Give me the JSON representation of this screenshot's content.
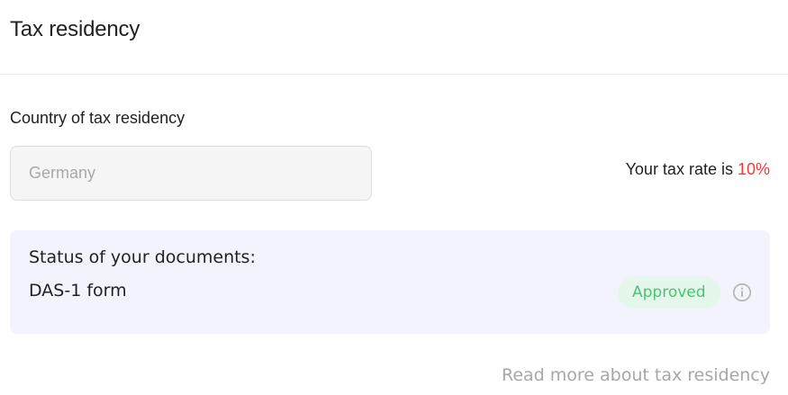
{
  "header": {
    "title": "Tax residency"
  },
  "tax_residency": {
    "country_label": "Country of tax residency",
    "country_placeholder": "Germany",
    "tax_rate_prefix": "Your tax rate is ",
    "tax_rate_value": "10%"
  },
  "documents": {
    "heading": "Status of your documents:",
    "items": [
      {
        "name": "DAS-1 form",
        "status": "Approved",
        "status_color": "#45c76c",
        "status_background": "#e5f7eb",
        "info_icon": "info-circle-icon"
      }
    ]
  },
  "links": {
    "read_more": "Read more about tax residency"
  },
  "colors": {
    "tax_rate_value": "#ef3b3b",
    "card_background": "#f3f3fd",
    "link_text": "#a7a7a7"
  }
}
